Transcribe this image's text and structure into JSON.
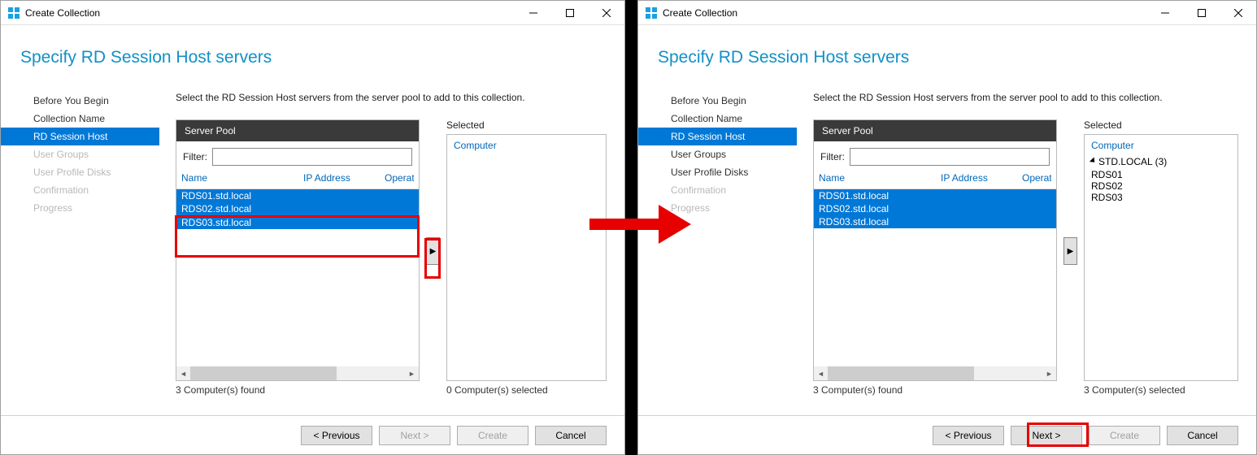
{
  "window": {
    "title": "Create Collection"
  },
  "page_title": "Specify RD Session Host servers",
  "instruction": "Select the RD Session Host servers from the server pool to add to this collection.",
  "nav": {
    "items": [
      {
        "label": "Before You Begin",
        "state": "normal"
      },
      {
        "label": "Collection Name",
        "state": "normal"
      },
      {
        "label": "RD Session Host",
        "state": "active"
      },
      {
        "label": "User Groups",
        "state": "disabled"
      },
      {
        "label": "User Profile Disks",
        "state": "disabled"
      },
      {
        "label": "Confirmation",
        "state": "disabled"
      },
      {
        "label": "Progress",
        "state": "disabled"
      }
    ]
  },
  "pool_header": "Server Pool",
  "filter_label": "Filter:",
  "filter_value": "",
  "columns": {
    "name": "Name",
    "ip": "IP Address",
    "op": "Operat"
  },
  "servers": [
    "RDS01.std.local",
    "RDS02.std.local",
    "RDS03.std.local"
  ],
  "count_left": "3 Computer(s) found",
  "selected_label": "Selected",
  "selected_header": "Computer",
  "left_pane": {
    "selected_count": "0 Computer(s) selected",
    "selected_items": [],
    "footer": {
      "prev": "< Previous",
      "next": "Next >",
      "create": "Create",
      "cancel": "Cancel",
      "next_enabled": false,
      "create_enabled": false
    }
  },
  "right_pane": {
    "selected_count": "3 Computer(s) selected",
    "selected_group": "STD.LOCAL (3)",
    "selected_items": [
      "RDS01",
      "RDS02",
      "RDS03"
    ],
    "footer": {
      "prev": "< Previous",
      "next": "Next >",
      "create": "Create",
      "cancel": "Cancel",
      "next_enabled": true,
      "create_enabled": false
    }
  }
}
